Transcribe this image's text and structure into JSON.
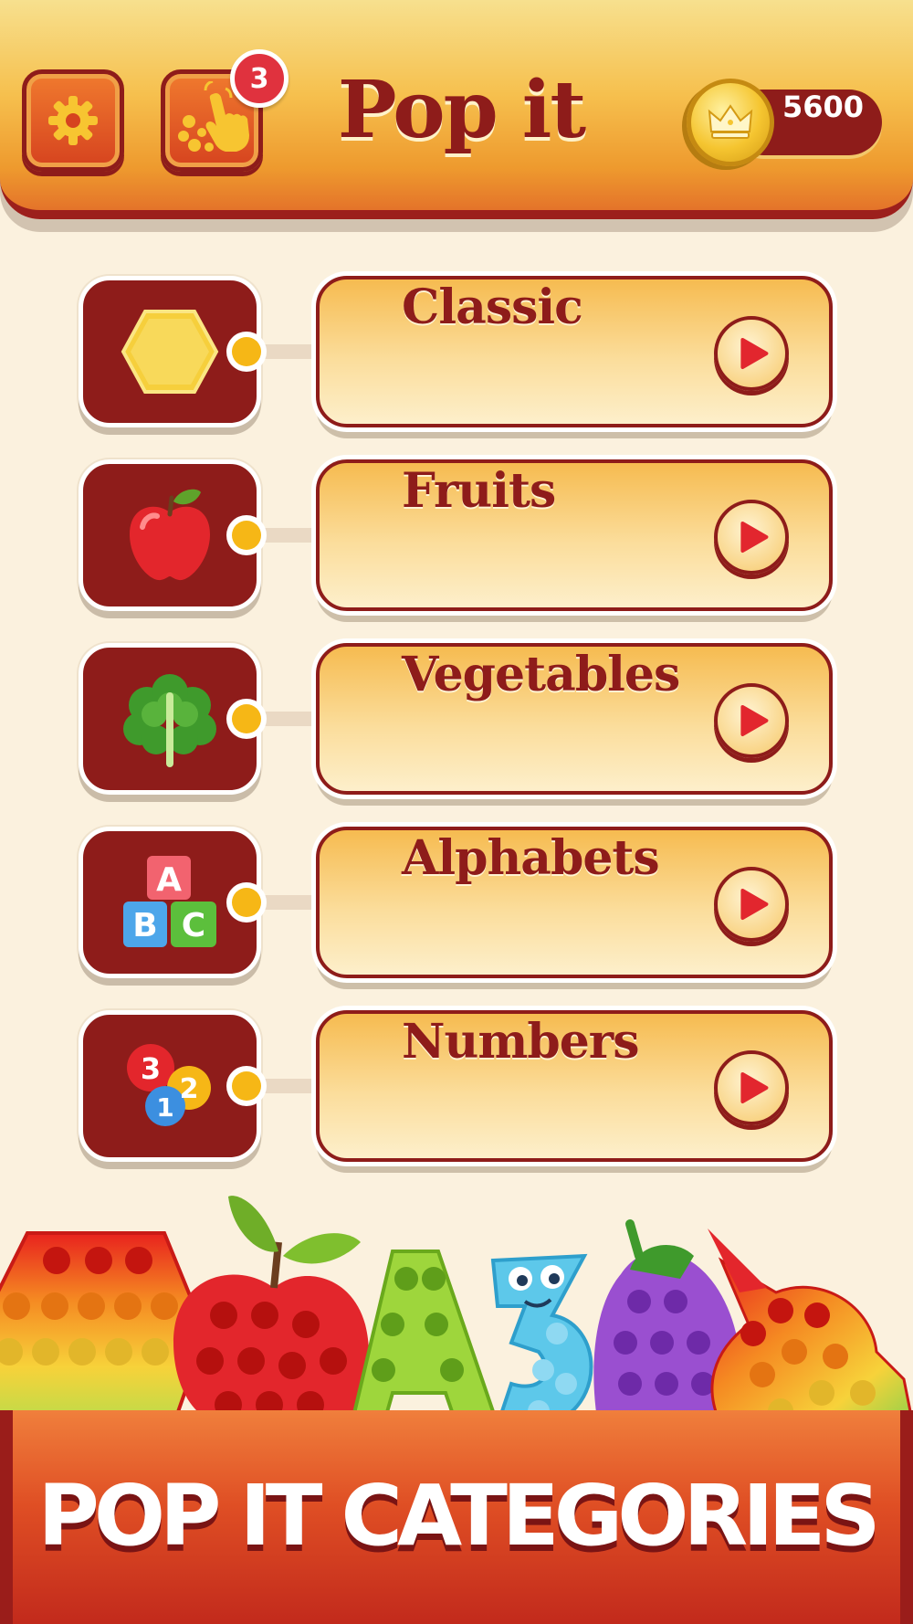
{
  "header": {
    "title": "Pop it",
    "settings_icon": "gear-icon",
    "hint_icon": "tap-hand-icon",
    "hint_badge": "3",
    "coins": "5600",
    "coin_icon": "crown-coin-icon"
  },
  "categories": [
    {
      "label": "Classic",
      "icon": "hexagon-icon"
    },
    {
      "label": "Fruits",
      "icon": "apple-icon"
    },
    {
      "label": "Vegetables",
      "icon": "lettuce-icon"
    },
    {
      "label": "Alphabets",
      "icon": "abc-blocks-icon"
    },
    {
      "label": "Numbers",
      "icon": "number-bubbles-icon"
    }
  ],
  "banner": {
    "title": "POP IT CATEGORIES"
  },
  "colors": {
    "brand_red": "#8e1c1a",
    "header_orange": "#ee9a2e",
    "card_gold": "#f6bb50",
    "background": "#fbf1de"
  }
}
